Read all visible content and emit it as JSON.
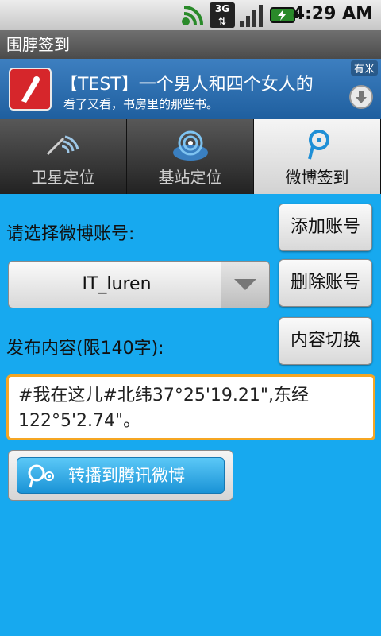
{
  "statusbar": {
    "time": "4:29 AM",
    "network": "3G"
  },
  "app": {
    "title": "围脖签到"
  },
  "ad": {
    "headline": "【TEST】一个男人和四个女人的",
    "subtext": "看了又看，书房里的那些书。",
    "brand": "有米"
  },
  "tabs": [
    {
      "label": "卫星定位",
      "icon": "satellite-icon",
      "active": false
    },
    {
      "label": "基站定位",
      "icon": "cell-tower-icon",
      "active": false
    },
    {
      "label": "微博签到",
      "icon": "weibo-icon",
      "active": true
    }
  ],
  "form": {
    "select_account_label": "请选择微博账号:",
    "add_account_button": "添加账号",
    "account_value": "IT_luren",
    "delete_account_button": "删除账号",
    "content_label": "发布内容(限140字):",
    "switch_content_button": "内容切换",
    "content_value": "#我在这儿#北纬37°25'19.21\",东经122°5'2.74\"。",
    "share_button": "转播到腾讯微博"
  },
  "colors": {
    "background": "#17a9ef",
    "focus_border": "#f5a623",
    "share_button": "#1a93d6"
  }
}
